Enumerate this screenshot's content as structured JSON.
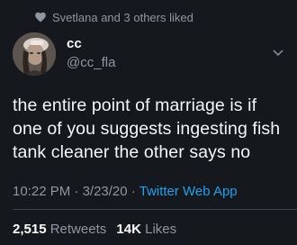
{
  "social_context": {
    "text": "Svetlana and 3 others liked",
    "icon": "heart-icon"
  },
  "author": {
    "display_name": "cc",
    "handle": "@cc_fla"
  },
  "tweet": {
    "text": "the entire point of marriage is if one of you suggests ingesting fish tank cleaner the other says no",
    "time": "10:22 PM",
    "date": "3/23/20",
    "separator": "·",
    "source": "Twitter Web App"
  },
  "stats": {
    "retweets_count": "2,515",
    "retweets_label": "Retweets",
    "likes_count": "14K",
    "likes_label": "Likes"
  },
  "colors": {
    "background": "#15181c",
    "secondary_text": "#8c98a3",
    "link": "#1da1f2"
  }
}
